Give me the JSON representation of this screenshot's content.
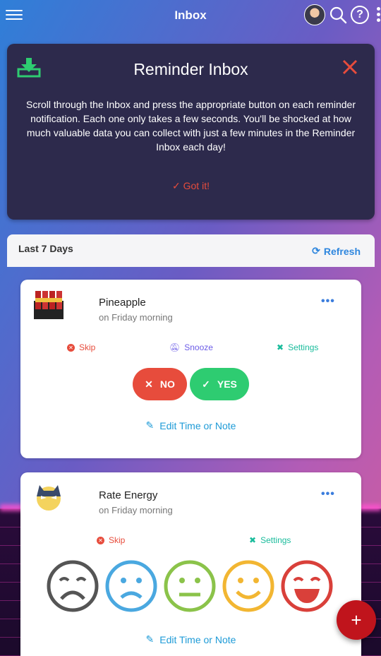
{
  "header": {
    "title": "Inbox"
  },
  "intro": {
    "title": "Reminder Inbox",
    "body": "Scroll through the Inbox and press the appropriate button on each reminder notification. Each one only takes a few seconds. You'll be shocked at how much valuable data you can collect with just a few minutes in the Reminder Inbox each day!",
    "got_it": "Got it!"
  },
  "section": {
    "label": "Last 7 Days",
    "refresh": "Refresh"
  },
  "cards": [
    {
      "name": "Pineapple",
      "when": "on Friday morning",
      "actions": {
        "skip": "Skip",
        "snooze": "Snooze",
        "settings": "Settings"
      },
      "no": "NO",
      "yes": "YES",
      "edit": "Edit Time or Note"
    },
    {
      "name": "Rate Energy",
      "when": "on Friday morning",
      "actions": {
        "skip": "Skip",
        "settings": "Settings"
      },
      "faces": [
        "very-sad-face-icon",
        "sad-face-icon",
        "neutral-face-icon",
        "happy-face-icon",
        "very-happy-face-icon"
      ],
      "face_colors": [
        "#555555",
        "#4aa8e0",
        "#8bc34a",
        "#f2b632",
        "#d9403a"
      ],
      "edit": "Edit Time or Note"
    }
  ],
  "fab": {
    "label": "+"
  },
  "colors": {
    "accent": "#2e86de",
    "danger": "#e74c3c",
    "success": "#2ecc71",
    "card_dark": "#2d2a4c"
  }
}
